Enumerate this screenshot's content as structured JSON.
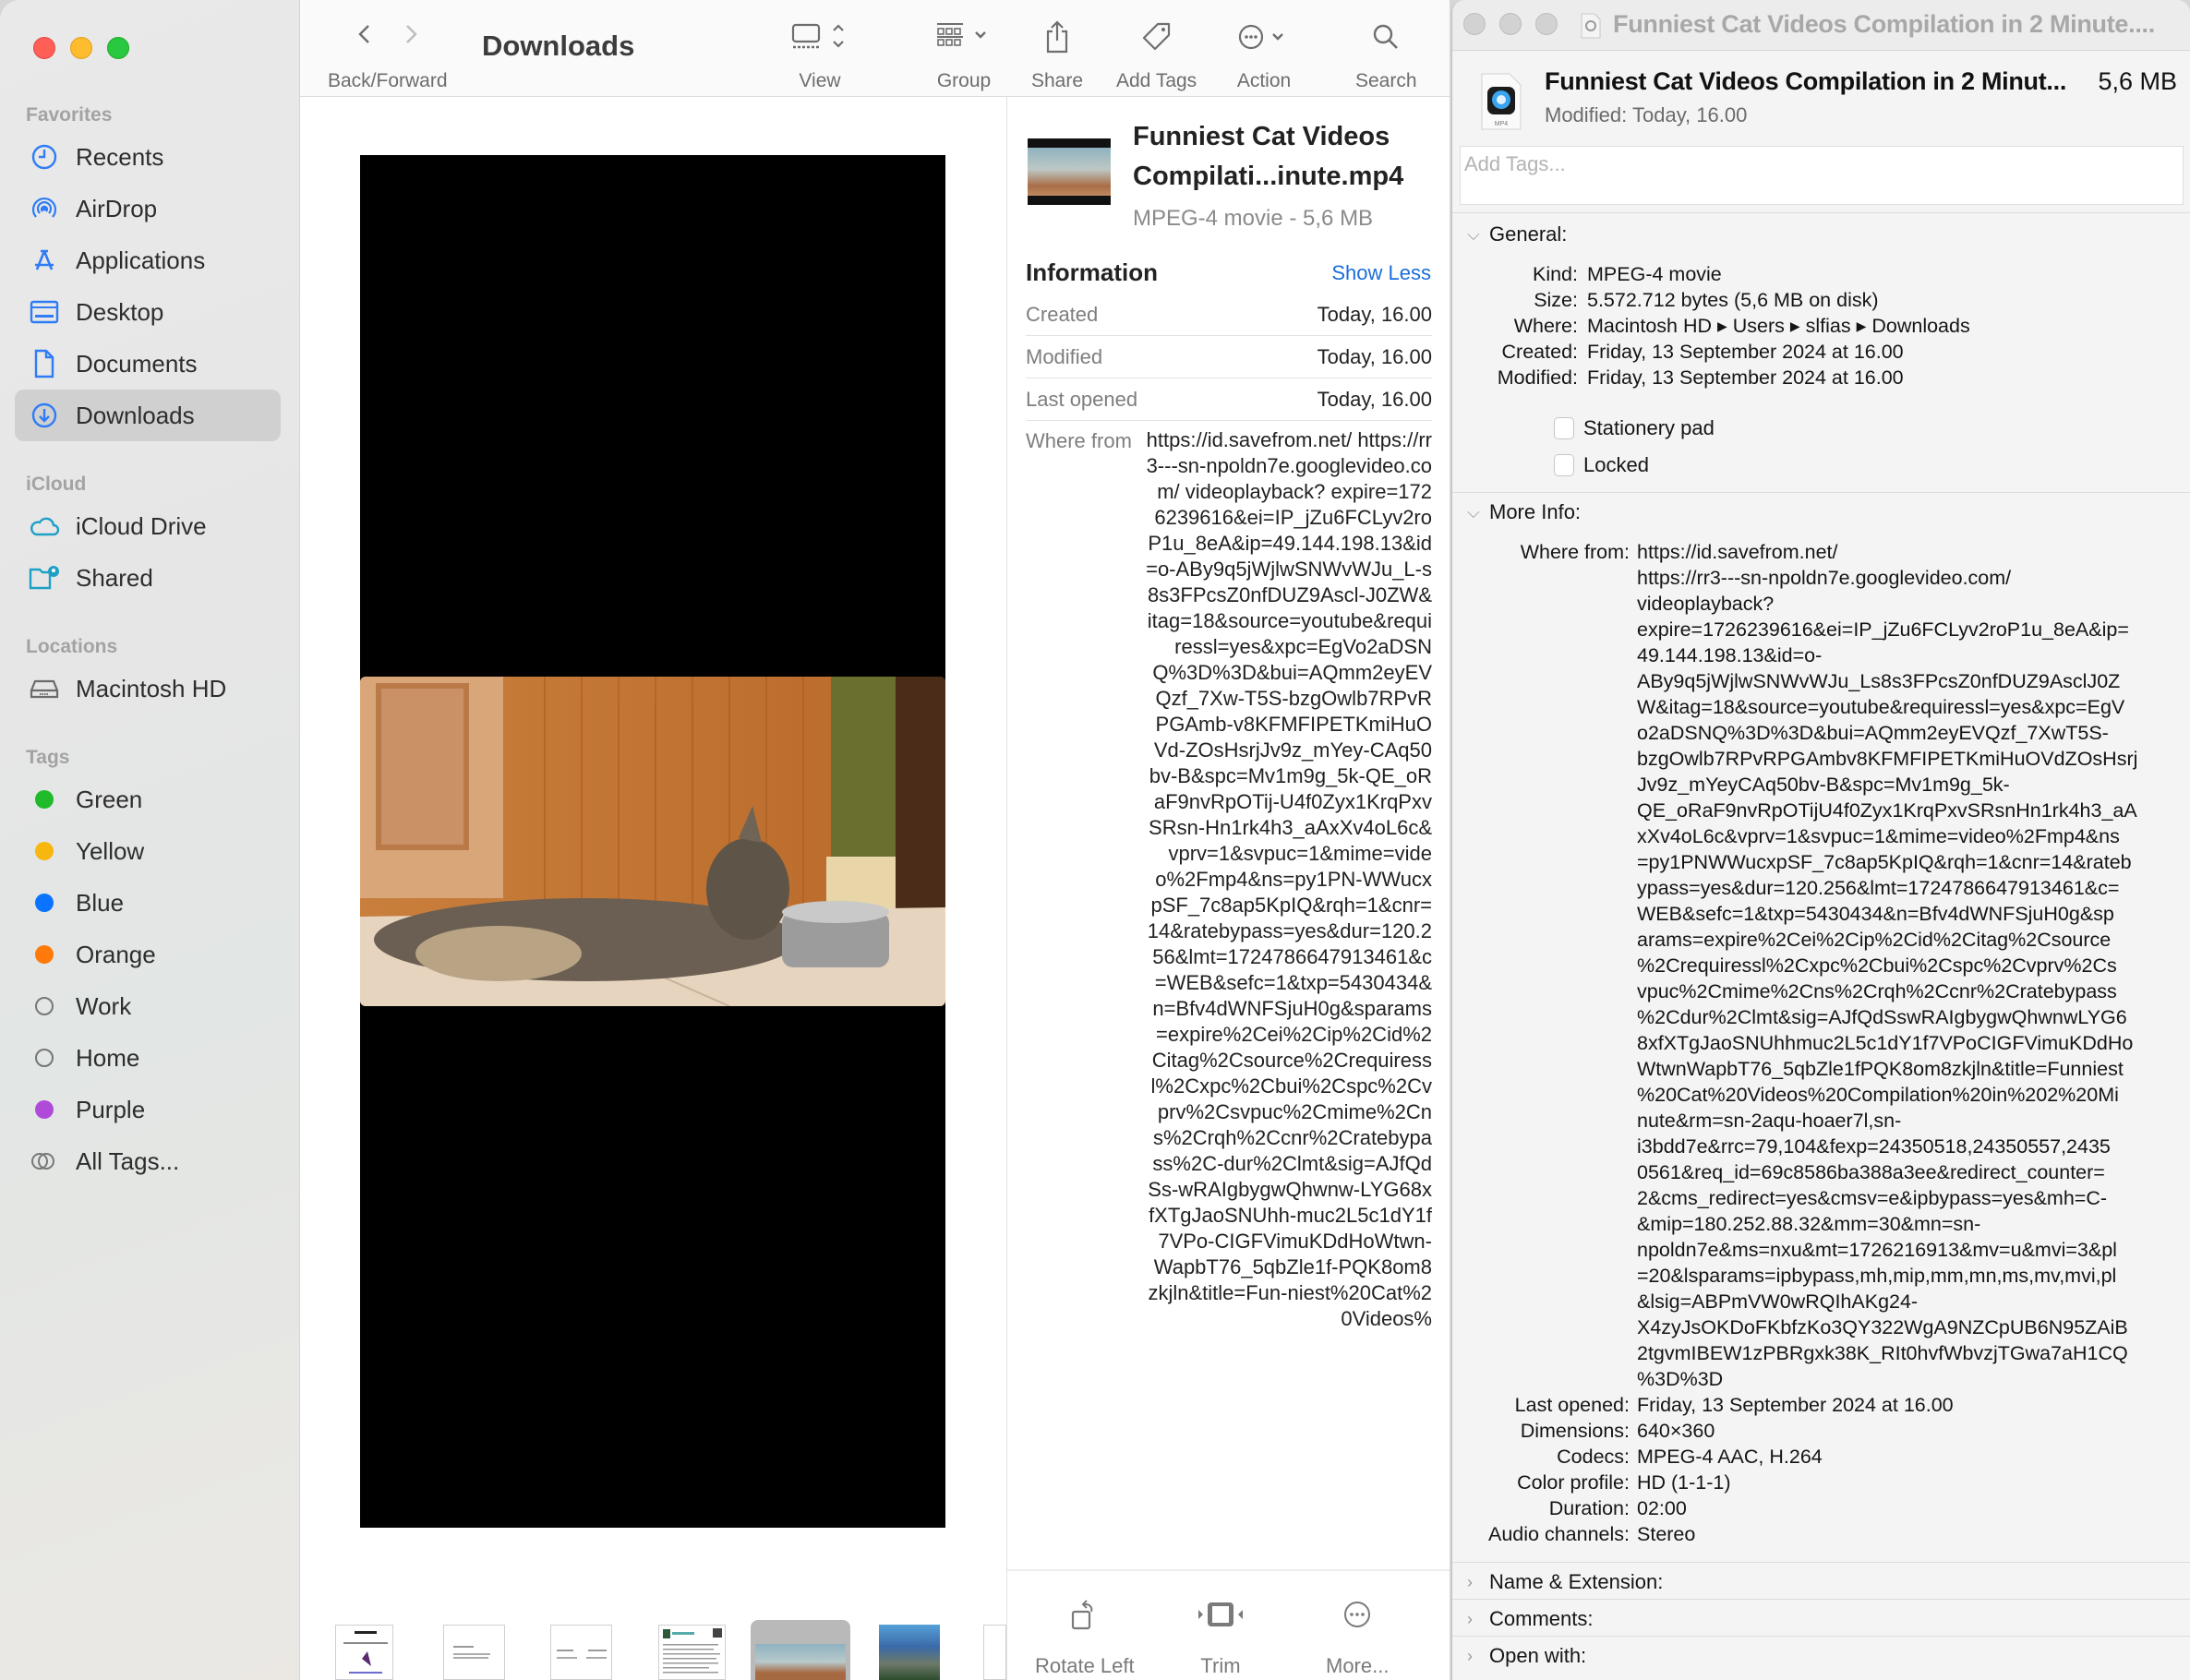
{
  "finder": {
    "window_controls": {
      "close_color": "#ff5f57",
      "minimize_color": "#febc2e",
      "zoom_color": "#28c840"
    },
    "sidebar": {
      "sections": [
        {
          "title": "Favorites",
          "items": [
            {
              "label": "Recents",
              "icon": "clock-icon"
            },
            {
              "label": "AirDrop",
              "icon": "airdrop-icon"
            },
            {
              "label": "Applications",
              "icon": "applications-icon"
            },
            {
              "label": "Desktop",
              "icon": "desktop-icon"
            },
            {
              "label": "Documents",
              "icon": "document-icon"
            },
            {
              "label": "Downloads",
              "icon": "download-icon",
              "selected": true
            }
          ]
        },
        {
          "title": "iCloud",
          "items": [
            {
              "label": "iCloud Drive",
              "icon": "cloud-icon"
            },
            {
              "label": "Shared",
              "icon": "shared-folder-icon"
            }
          ]
        },
        {
          "title": "Locations",
          "items": [
            {
              "label": "Macintosh HD",
              "icon": "hard-drive-icon"
            }
          ]
        },
        {
          "title": "Tags",
          "items": [
            {
              "label": "Green",
              "color": "#1fbb2a"
            },
            {
              "label": "Yellow",
              "color": "#f8b70e"
            },
            {
              "label": "Blue",
              "color": "#0a73ff"
            },
            {
              "label": "Orange",
              "color": "#ff7a0a"
            },
            {
              "label": "Work",
              "color": ""
            },
            {
              "label": "Home",
              "color": ""
            },
            {
              "label": "Purple",
              "color": "#b04bd9"
            },
            {
              "label": "All Tags...",
              "icon": "all-tags-icon"
            }
          ]
        }
      ]
    },
    "toolbar": {
      "title": "Downloads",
      "back_forward_label": "Back/Forward",
      "view_label": "View",
      "group_label": "Group",
      "share_label": "Share",
      "add_tags_label": "Add Tags",
      "action_label": "Action",
      "search_label": "Search"
    },
    "preview": {
      "thumbnails": [
        "Sociology document",
        "letter document",
        "two-column document",
        "research insight document",
        "Funniest Cat Videos video",
        "Sosialisasi photo",
        "document"
      ],
      "selected_thumbnail": 4
    },
    "info_pane": {
      "file_name": "Funniest Cat Videos Compilati...inute.mp4",
      "file_name_line1": "Funniest Cat Videos",
      "file_name_line2": "Compilati...inute.mp4",
      "kind_size": "MPEG-4 movie - 5,6 MB",
      "heading": "Information",
      "show_less": "Show Less",
      "rows": [
        {
          "label": "Created",
          "value": "Today, 16.00"
        },
        {
          "label": "Modified",
          "value": "Today, 16.00"
        },
        {
          "label": "Last opened",
          "value": "Today, 16.00"
        }
      ],
      "where_from_label": "Where from",
      "where_from_value": "https://id.savefrom.net/ https://rr3---sn-npoldn7e.googlevideo.com/ videoplayback? expire=1726239616&ei=IP_jZu6FCLyv2roP1u_8eA&ip=49.144.198.13&id=o-ABy9q5jWjlwSNWvWJu_L-s8s3FPcsZ0nfDUZ9Ascl-J0ZW&itag=18&source=youtube&requiressl=yes&xpc=EgVo2aDSNQ%3D%3D&bui=AQmm2eyEVQzf_7Xw-T5S-bzgOwlb7RPvRPGAmb-v8KFMFIPETKmiHuOVd-ZOsHsrjJv9z_mYey-CAq50bv-B&spc=Mv1m9g_5k-QE_oRaF9nvRpOTij-U4f0Zyx1KrqPxvSRsn-Hn1rk4h3_aAxXv4oL6c&vprv=1&svpuc=1&mime=video%2Fmp4&ns=py1PN-WWucxpSF_7c8ap5KpIQ&rqh=1&cnr=14&ratebypass=yes&dur=120.256&lmt=1724786647913461&c=WEB&sefc=1&txp=5430434&n=Bfv4dWNFSjuH0g&sparams=expire%2Cei%2Cip%2Cid%2Citag%2Csource%2Crequiressl%2Cxpc%2Cbui%2Cspc%2Cvprv%2Csvpuc%2Cmime%2Cns%2Crqh%2Ccnr%2Cratebypass%2C-dur%2Clmt&sig=AJfQdSs-wRAIgbygwQhwnw-LYG68xfXTgJaoSNUhh-muc2L5c1dY1f7VPo-CIGFVimuKDdHoWtwn-WapbT76_5qbZle1f-PQK8om8zkjln&title=Fun-niest%20Cat%20Videos%",
      "actions": [
        {
          "label": "Rotate Left",
          "icon": "rotate-left-icon"
        },
        {
          "label": "Trim",
          "icon": "trim-icon"
        },
        {
          "label": "More...",
          "icon": "more-icon"
        }
      ]
    }
  },
  "get_info": {
    "window_title": "Funniest Cat Videos Compilation in 2 Minute....",
    "file_name": "Funniest Cat Videos Compilation in 2 Minut...",
    "file_size": "5,6 MB",
    "file_type_badge": "MP4",
    "modified_line": "Modified: Today, 16.00",
    "tags_placeholder": "Add Tags...",
    "general": {
      "heading": "General:",
      "rows": [
        {
          "label": "Kind:",
          "value": "MPEG-4 movie"
        },
        {
          "label": "Size:",
          "value": "5.572.712 bytes (5,6 MB on disk)"
        },
        {
          "label": "Where:",
          "value": "Macintosh HD ▸ Users ▸ slfias ▸ Downloads"
        },
        {
          "label": "Created:",
          "value": "Friday, 13 September 2024 at 16.00"
        },
        {
          "label": "Modified:",
          "value": "Friday, 13 September 2024 at 16.00"
        }
      ],
      "stationery_pad_label": "Stationery pad",
      "stationery_pad_checked": false,
      "locked_label": "Locked",
      "locked_checked": false
    },
    "more_info": {
      "heading": "More Info:",
      "where_from_label": "Where from:",
      "where_from_lines": [
        "https://id.savefrom.net/",
        "https://rr3---sn-npoldn7e.googlevideo.com/",
        "videoplayback?",
        "expire=1726239616&ei=IP_jZu6FCLyv2roP1u_8eA&ip=",
        "49.144.198.13&id=o-",
        "ABy9q5jWjlwSNWvWJu_Ls8s3FPcsZ0nfDUZ9AsclJ0Z",
        "W&itag=18&source=youtube&requiressl=yes&xpc=EgV",
        "o2aDSNQ%3D%3D&bui=AQmm2eyEVQzf_7XwT5S-",
        "bzgOwlb7RPvRPGAmbv8KFMFIPETKmiHuOVdZOsHsrj",
        "Jv9z_mYeyCAq50bv-B&spc=Mv1m9g_5k-",
        "QE_oRaF9nvRpOTijU4f0Zyx1KrqPxvSRsnHn1rk4h3_aA",
        "xXv4oL6c&vprv=1&svpuc=1&mime=video%2Fmp4&ns",
        "=py1PNWWucxpSF_7c8ap5KpIQ&rqh=1&cnr=14&rateb",
        "ypass=yes&dur=120.256&lmt=1724786647913461&c=",
        "WEB&sefc=1&txp=5430434&n=Bfv4dWNFSjuH0g&sp",
        "arams=expire%2Cei%2Cip%2Cid%2Citag%2Csource",
        "%2Crequiressl%2Cxpc%2Cbui%2Cspc%2Cvprv%2Cs",
        "vpuc%2Cmime%2Cns%2Crqh%2Ccnr%2Cratebypass",
        "%2Cdur%2Clmt&sig=AJfQdSswRAIgbygwQhwnwLYG6",
        "8xfXTgJaoSNUhhmuc2L5c1dY1f7VPoCIGFVimuKDdHo",
        "WtwnWapbT76_5qbZle1fPQK8om8zkjln&title=Funniest",
        "%20Cat%20Videos%20Compilation%20in%202%20Mi",
        "nute&rm=sn-2aqu-hoaer7l,sn-",
        "i3bdd7e&rrc=79,104&fexp=24350518,24350557,2435",
        "0561&req_id=69c8586ba388a3ee&redirect_counter=",
        "2&cms_redirect=yes&cmsv=e&ipbypass=yes&mh=C-",
        "&mip=180.252.88.32&mm=30&mn=sn-",
        "npoldn7e&ms=nxu&mt=1726216913&mv=u&mvi=3&pl",
        "=20&lsparams=ipbypass,mh,mip,mm,mn,ms,mv,mvi,pl",
        "&lsig=ABPmVW0wRQIhAKg24-",
        "X4zyJsOKDoFKbfzKo3QY322WgA9NZCpUB6N95ZAiB",
        "2tgvmIBEW1zPBRgxk38K_RIt0hvfWbvzjTGwa7aH1CQ",
        "%3D%3D"
      ],
      "rows": [
        {
          "label": "Last opened:",
          "value": "Friday, 13 September 2024 at 16.00"
        },
        {
          "label": "Dimensions:",
          "value": "640×360"
        },
        {
          "label": "Codecs:",
          "value": "MPEG-4 AAC, H.264"
        },
        {
          "label": "Color profile:",
          "value": "HD (1-1-1)"
        },
        {
          "label": "Duration:",
          "value": "02:00"
        },
        {
          "label": "Audio channels:",
          "value": "Stereo"
        }
      ]
    },
    "collapsed_sections": [
      "Name & Extension:",
      "Comments:",
      "Open with:"
    ]
  }
}
